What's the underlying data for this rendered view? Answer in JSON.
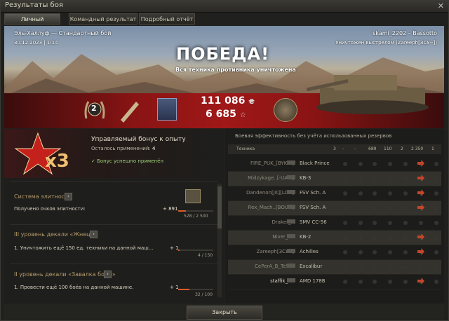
{
  "window": {
    "title": "Результаты боя",
    "close_glyph": "✕"
  },
  "tabs": [
    {
      "label": "Личный результат",
      "active": true
    },
    {
      "label": "Командный результат",
      "active": false
    },
    {
      "label": "Подробный отчёт",
      "active": false
    }
  ],
  "hero": {
    "map_mode": "Эль-Халлуф — Стандартный бой",
    "datetime": "30.12.2023 | 1:14",
    "player": "skami_2202 – Bassotto",
    "destroyed_by": "Уничтожен выстрелом (Zareeph[ЗСУ--])",
    "result": "ПОБЕДА!",
    "subtitle": "Вся техника противника уничтожена",
    "rank": "2",
    "credits": "111 086",
    "credits_icon": "₴",
    "xp": "6 685",
    "xp_icon": "☆"
  },
  "bonus": {
    "multiplier": "x3",
    "title": "Управляемый бонус к опыту",
    "remaining_label": "Осталось применений:",
    "remaining_value": "4",
    "applied_text": "✓ Бонус успешно применён"
  },
  "progress": {
    "elite": {
      "title": "Система элитности",
      "row": "Получено очков элитности:",
      "plus": "+ 891",
      "count": "528 / 2 500",
      "fraction": 0.21
    },
    "decal1": {
      "title": "III уровень декали «Жнец»",
      "row": "1. Уничтожить ещё 150 ед. техники на данной маш...",
      "plus": "+ 1",
      "count": "4 / 150",
      "fraction": 0.03
    },
    "decal2": {
      "title": "II уровень декали «Завалка боем»",
      "row": "1. Провести ещё 100 боёв на данной машине.",
      "plus": "+ 1",
      "count": "32 / 100",
      "fraction": 0.32
    }
  },
  "efficiency": {
    "caption": "Боевая эффективность без учёта использованных резервов",
    "headers": {
      "tech": "Техника",
      "c1": "3",
      "c2": "-",
      "c3": "-",
      "c4": "689",
      "c5": "110",
      "c6": "2",
      "c7": "2 350",
      "c8": "1"
    },
    "rows": [
      {
        "player": "FIRE_PUK_[BYKPr]",
        "tank": "Black Prince",
        "me": false
      },
      {
        "player": "Midzykage..[-UA-L]",
        "tank": "KB-3",
        "me": false
      },
      {
        "player": "Dandenon[JK][LON]",
        "tank": "FSV Sch. A",
        "me": false
      },
      {
        "player": "Rex_Mach..[BOUH]",
        "tank": "FSV Sch. A",
        "me": false
      },
      {
        "player": "Draker_1",
        "tank": "SMV CC-56",
        "me": false
      },
      {
        "player": "Niver_BY",
        "tank": "KB-2",
        "me": false
      },
      {
        "player": "Zareeph[ЗСУ--]",
        "tank": "Achilles",
        "me": false
      },
      {
        "player": "CePerA_B_TeStE",
        "tank": "Excalibur",
        "me": false
      },
      {
        "player": "staffik_21",
        "tank": "AMD 178B",
        "me": true
      }
    ]
  },
  "footer": {
    "close_label": "Закрыть"
  }
}
